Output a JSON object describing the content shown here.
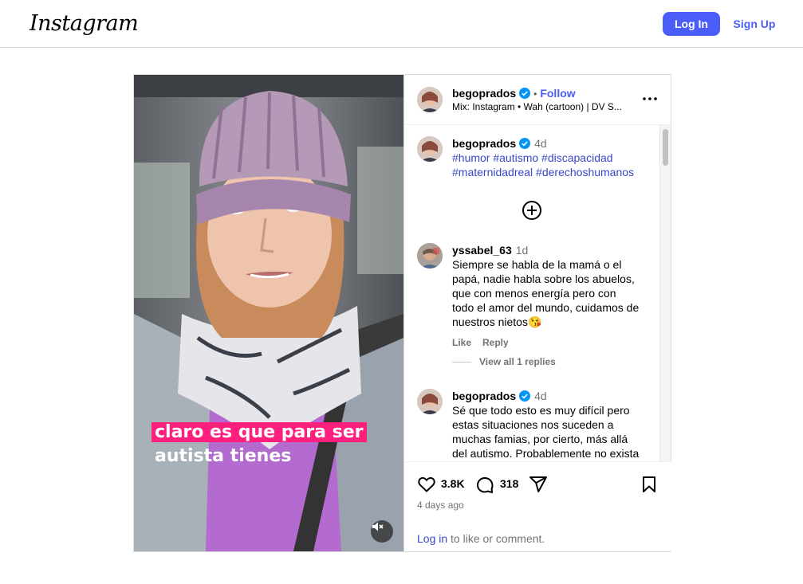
{
  "header": {
    "logo": "Instagram",
    "login_label": "Log In",
    "signup_label": "Sign Up"
  },
  "media": {
    "overlay_line1": "claro es que para ser",
    "overlay_line2": "autista tienes",
    "mute_icon": "speaker-muted-icon"
  },
  "post": {
    "username": "begoprados",
    "follow_label": "Follow",
    "music": "Mix: Instagram • Wah (cartoon) | DV S..."
  },
  "comments": [
    {
      "username": "begoprados",
      "time": "4d",
      "hashtags_line1": "#humor #autismo #discapacidad",
      "hashtags_line2": "#maternidadreal #derechoshumanos"
    },
    {
      "username": "yssabel_63",
      "time": "1d",
      "lines": [
        "Siempre se habla de la mamá o el",
        "papá, nadie habla sobre los abuelos,",
        "que con menos energía pero con",
        "todo el amor del mundo, cuidamos de",
        "nuestros nietos😘"
      ],
      "like_label": "Like",
      "reply_label": "Reply",
      "view_replies": "View all 1 replies"
    },
    {
      "username": "begoprados",
      "time": "4d",
      "lines": [
        "Sé que todo esto es muy difícil pero",
        "estas situaciones nos suceden a",
        "muchas famias, por cierto, más allá",
        "del autismo. Probablemente no exista"
      ]
    }
  ],
  "footer": {
    "likes": "3.8K",
    "comments": "318",
    "posted_ago": "4 days ago",
    "login_link": "Log in",
    "login_rest": " to like or comment."
  },
  "colors": {
    "accent": "#4a5df9",
    "hashtag": "#3848c6",
    "overlay_highlight": "#ff1f7d"
  }
}
